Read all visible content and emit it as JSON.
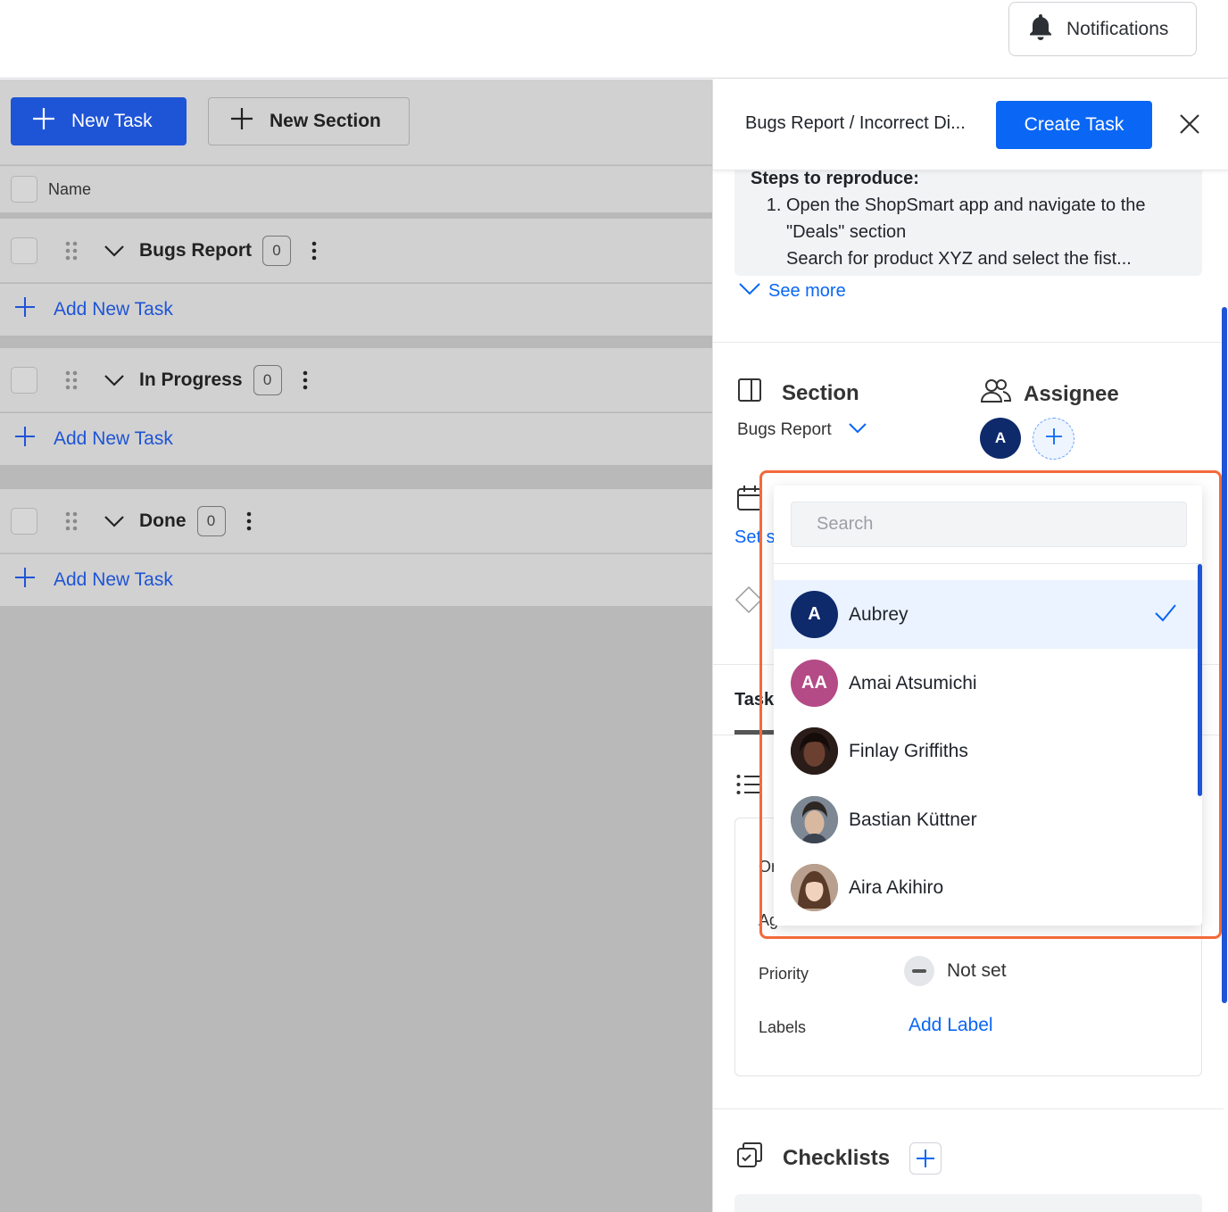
{
  "header": {
    "notifications_label": "Notifications"
  },
  "toolbar": {
    "new_task_label": "New Task",
    "new_section_label": "New Section"
  },
  "list": {
    "name_header": "Name",
    "add_task_label": "Add New Task",
    "sections": [
      {
        "title": "Bugs Report",
        "count": "0"
      },
      {
        "title": "In Progress",
        "count": "0"
      },
      {
        "title": "Done",
        "count": "0"
      }
    ]
  },
  "panel": {
    "breadcrumb": "Bugs Report  / Incorrect Di...",
    "create_task_label": "Create Task",
    "description": {
      "heading": "Steps to reproduce:",
      "steps": [
        "Open the ShopSmart app and navigate to the \"Deals\" section",
        "Search for product XYZ and select the fist..."
      ],
      "see_more": "See more"
    },
    "section_label": "Section",
    "section_value": "Bugs Report",
    "assignee_label": "Assignee",
    "assignee_initial": "A",
    "partial_date_text": "Set s",
    "partial_tab_text": "Task",
    "partial_or_text": "Or",
    "partial_age_text": "Ag",
    "priority_label": "Priority",
    "priority_value": "Not set",
    "labels_label": "Labels",
    "add_label": "Add Label",
    "checklists_label": "Checklists"
  },
  "assignee_dropdown": {
    "search_placeholder": "Search",
    "users": [
      {
        "name": "Aubrey",
        "initials": "A",
        "color": "#0e2a6b",
        "selected": true
      },
      {
        "name": "Amai Atsumichi",
        "initials": "AA",
        "color": "#b44a86",
        "selected": false
      },
      {
        "name": "Finlay Griffiths",
        "initials": "",
        "color": "#3a2a24",
        "selected": false
      },
      {
        "name": "Bastian Küttner",
        "initials": "",
        "color": "#5a6470",
        "selected": false
      },
      {
        "name": "Aira Akihiro",
        "initials": "",
        "color": "#8a6a58",
        "selected": false
      }
    ]
  },
  "colors": {
    "primary": "#1e54d6",
    "link": "#0a66f5",
    "highlight": "#f26a3b"
  }
}
